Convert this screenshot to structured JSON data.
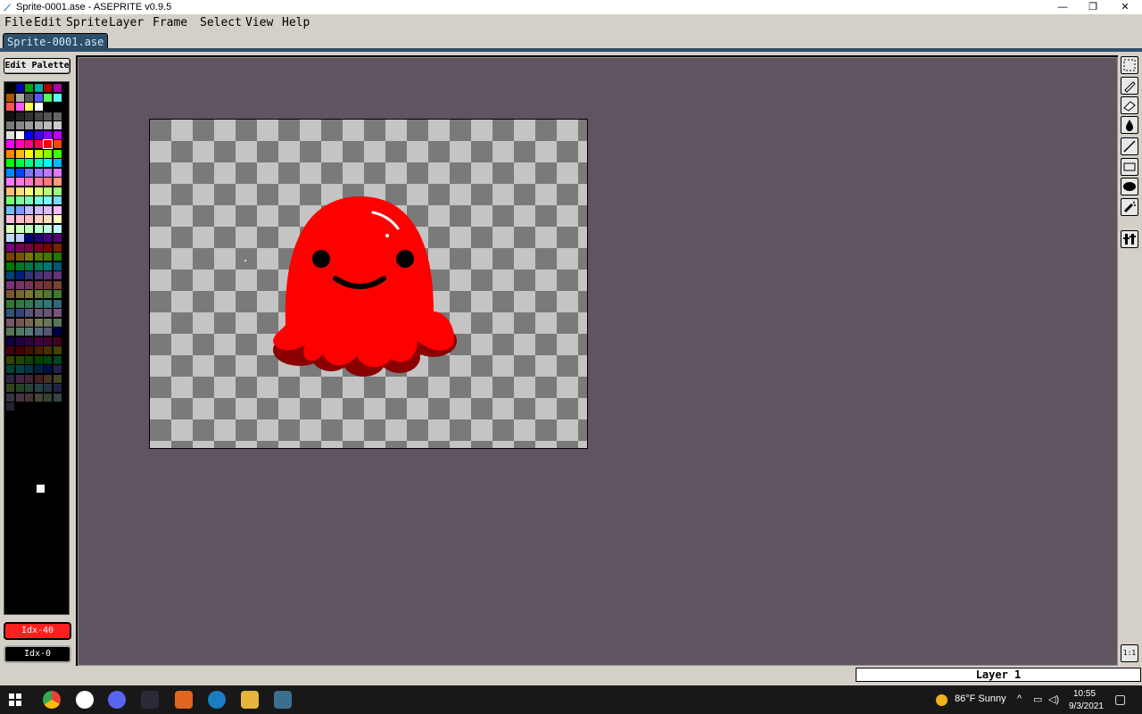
{
  "window": {
    "title": "Sprite-0001.ase - ASEPRITE v0.9.5",
    "minimize": "—",
    "maximize": "❐",
    "close": "✕"
  },
  "menu": [
    "File",
    "Edit",
    "Sprite",
    "Layer",
    "Frame",
    "Select",
    "View",
    "Help"
  ],
  "tabs": [
    {
      "label": "Sprite-0001.ase"
    }
  ],
  "palette_panel": {
    "edit_button": "Edit Palette",
    "fg_label": "Idx-40",
    "bg_label": "Idx-0",
    "fg_color": "#ff1f1f",
    "bg_color": "#000000"
  },
  "tools": [
    "rectangle-select-icon",
    "pencil-icon",
    "eraser-icon",
    "bucket-fill-icon",
    "line-icon",
    "rectangle-icon",
    "ellipse-icon",
    "spray-icon",
    "tool-settings-icon"
  ],
  "zoom_button": "1:1",
  "status": {
    "layer": "Layer 1"
  },
  "taskbar": {
    "weather": "86°F  Sunny",
    "time": "10:55",
    "date": "9/3/2021"
  },
  "colors": {
    "editor_bg": "#615461",
    "accent": "#2c4f6b",
    "sprite_red": "#ff0000"
  }
}
